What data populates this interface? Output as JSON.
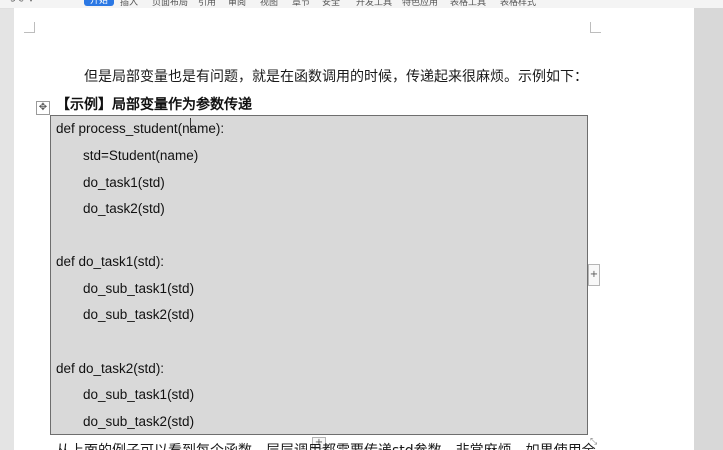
{
  "ribbon": {
    "tabs": [
      "开始",
      "插入",
      "页面布局",
      "引用",
      "审阅",
      "视图",
      "章节",
      "安全",
      "开发工具",
      "特色应用",
      "表格工具",
      "表格样式"
    ],
    "active_tab": "开始"
  },
  "document": {
    "intro": "但是局部变量也是有问题，就是在函数调用的时候，传递起来很麻烦。示例如下：",
    "heading": "【示例】局部变量作为参数传递",
    "code_lines": [
      "def process_student(name):",
      "std=Student(name)",
      "do_task1(std)",
      "do_task2(std)",
      "",
      "def do_task1(std):",
      "do_sub_task1(std)",
      "do_sub_task2(std)",
      "",
      "def do_task2(std):",
      "do_sub_task1(std)",
      "do_sub_task2(std)"
    ],
    "cutoff_text": "从上面的例子可以看到每个函数，层层调用都需要传递std参数，非常麻烦，如果使用全"
  },
  "controls": {
    "move_handle": "✥",
    "add_column": "+",
    "add_row": "+",
    "resize": "⤡"
  }
}
